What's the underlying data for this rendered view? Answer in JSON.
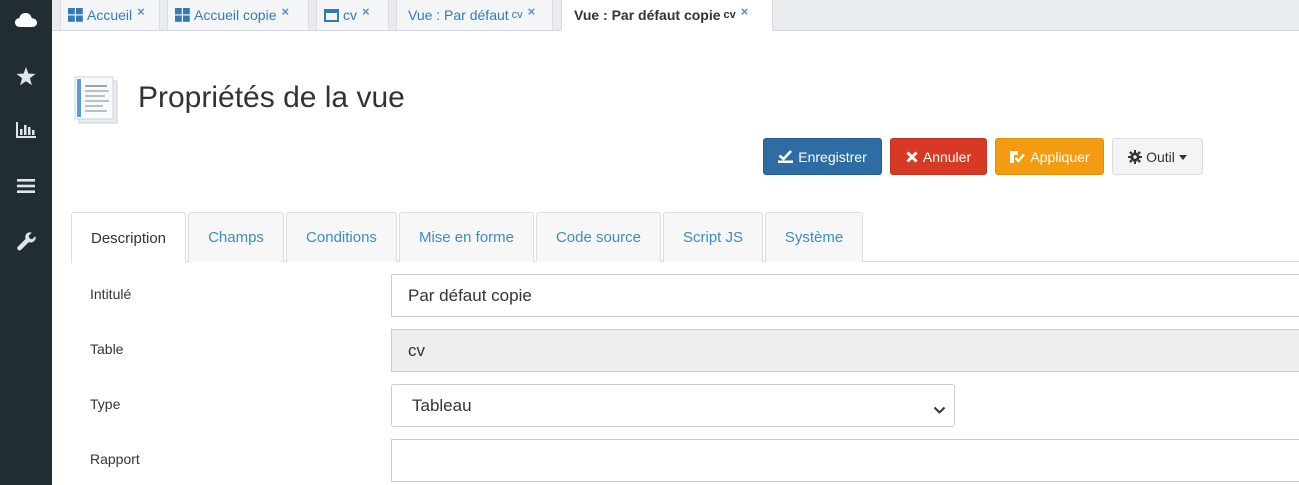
{
  "sidebar": {
    "items": [
      {
        "icon": "cloud-icon"
      },
      {
        "icon": "star-icon"
      },
      {
        "icon": "bar-chart-icon"
      },
      {
        "icon": "menu-icon"
      },
      {
        "icon": "wrench-icon"
      }
    ]
  },
  "window_tabs": [
    {
      "label": "Accueil",
      "icon": "dashboard-grid-icon",
      "close": "×"
    },
    {
      "label": "Accueil copie",
      "icon": "dashboard-grid-icon",
      "close": "×"
    },
    {
      "label": "cv",
      "icon": "window-icon",
      "close": "×"
    },
    {
      "label": "Vue : Par défaut",
      "suffix": "cv",
      "close": "×"
    },
    {
      "label": "Vue : Par défaut copie",
      "suffix": "cv",
      "close": "×",
      "active": true
    }
  ],
  "header": {
    "title": "Propriétés de la vue"
  },
  "toolbar": {
    "save_label": "Enregistrer",
    "cancel_label": "Annuler",
    "apply_label": "Appliquer",
    "tool_label": "Outil"
  },
  "form_tabs": [
    "Description",
    "Champs",
    "Conditions",
    "Mise en forme",
    "Code source",
    "Script JS",
    "Système"
  ],
  "form": {
    "intitule_label": "Intitulé",
    "intitule_value": "Par défaut copie",
    "table_label": "Table",
    "table_value": "cv",
    "type_label": "Type",
    "type_value": "Tableau",
    "rapport_label": "Rapport",
    "rapport_value": ""
  },
  "colors": {
    "sidebar_bg": "#222d32",
    "save": "#2e6da4",
    "cancel": "#d73925",
    "apply": "#f39c12",
    "tab_link": "#3c8dbc"
  }
}
